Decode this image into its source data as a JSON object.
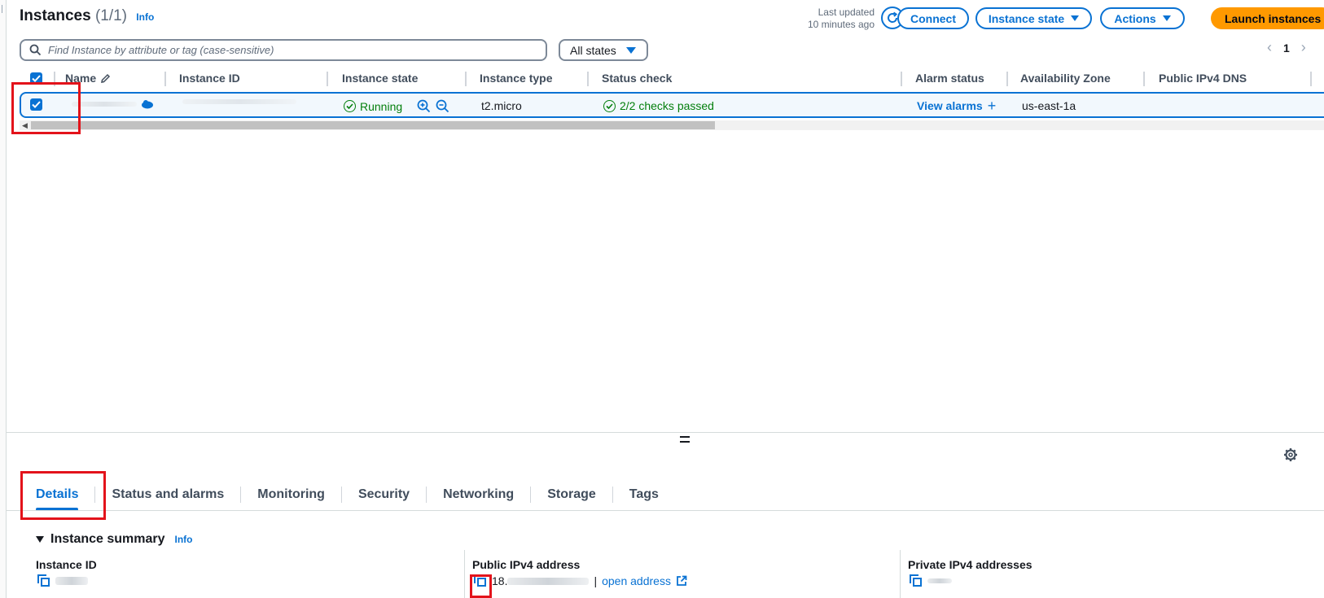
{
  "header": {
    "title": "Instances",
    "count": "(1/1)",
    "info": "Info",
    "last_updated_label": "Last updated",
    "last_updated_value": "10 minutes ago",
    "connect": "Connect",
    "instance_state": "Instance state",
    "actions": "Actions",
    "launch": "Launch instances"
  },
  "filter": {
    "placeholder": "Find Instance by attribute or tag (case-sensitive)",
    "states": "All states",
    "page": "1"
  },
  "table": {
    "columns": {
      "name": "Name",
      "instance_id": "Instance ID",
      "instance_state": "Instance state",
      "instance_type": "Instance type",
      "status_check": "Status check",
      "alarm_status": "Alarm status",
      "availability_zone": "Availability Zone",
      "public_dns": "Public IPv4 DNS"
    },
    "row": {
      "state": "Running",
      "type": "t2.micro",
      "status_check": "2/2 checks passed",
      "alarm": "View alarms",
      "az": "us-east-1a"
    }
  },
  "details": {
    "tabs": [
      "Details",
      "Status and alarms",
      "Monitoring",
      "Security",
      "Networking",
      "Storage",
      "Tags"
    ],
    "summary_title": "Instance summary",
    "summary_info": "Info",
    "instance_id_label": "Instance ID",
    "public_ipv4_label": "Public IPv4 address",
    "public_ipv4_prefix": "18.",
    "open_address": "open address",
    "private_ipv4_label": "Private IPv4 addresses"
  },
  "colors": {
    "link": "#0972d3",
    "success": "#037f0c",
    "primary": "#ff9900",
    "highlight": "#e3131b"
  }
}
